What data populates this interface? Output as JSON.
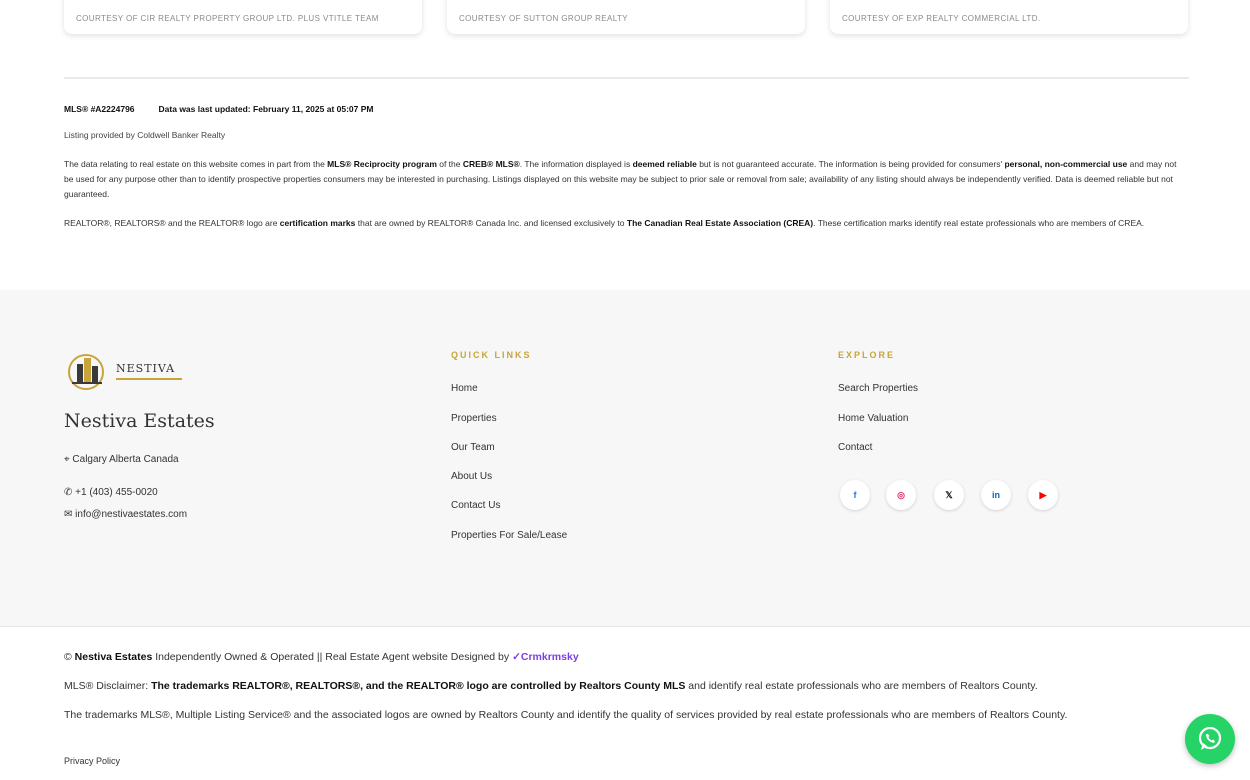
{
  "cards": [
    {
      "credit": "Courtesy of CIR Realty Property Group Ltd. Plus vTitle Team"
    },
    {
      "credit": "Courtesy of Sutton Group Realty"
    },
    {
      "credit": "Courtesy of Exp Realty Commercial Ltd."
    }
  ],
  "disclaimer": {
    "mls": "MLS® #A2224796",
    "updated": "Data was last updated: February 11, 2025 at 05:07 PM",
    "listing": "Listing provided by Coldwell Banker Realty",
    "p1_start": "The data relating to real estate on this website comes in part from the ",
    "p1_b1": "MLS® Reciprocity program",
    "p1_mid1": " of the ",
    "p1_b2": "CREB® MLS®",
    "p1_mid2": ". The information displayed is ",
    "p1_b3": "deemed reliable",
    "p1_mid3": " but is not guaranteed accurate. The information is being provided for consumers' ",
    "p1_b4": "personal, non-commercial use",
    "p1_end": " and may not be used for any purpose other than to identify prospective properties consumers may be interested in purchasing. Listings displayed on this website may be subject to prior sale or removal from sale; availability of any listing should always be independently verified. Data is deemed reliable but not guaranteed.",
    "p2_start": "REALTOR®, REALTORS® and the REALTOR® logo are ",
    "p2_b1": "certification marks",
    "p2_mid": " that are owned by REALTOR® Canada Inc. and licensed exclusively to ",
    "p2_b2": "The Canadian Real Estate Association (CREA)",
    "p2_end": ". These certification marks identify real estate professionals who are members of CREA."
  },
  "footer": {
    "logo_text": "NESTIVA",
    "brand_name": "Nestiva Estates",
    "address": "Calgary Alberta Canada",
    "phone": "+1 (403) 455-0020",
    "email": "info@nestivaestates.com",
    "quick_links": {
      "title": "Quick Links",
      "items": [
        "Home",
        "Properties",
        "Our Team",
        "About Us",
        "Contact Us",
        "Properties For Sale/Lease"
      ]
    },
    "explore": {
      "title": "Explore",
      "items": [
        "Search Properties",
        "Home Valuation",
        "Contact"
      ]
    },
    "social": [
      {
        "icon": "facebook-icon",
        "glyph": "f",
        "color": "#1877f2"
      },
      {
        "icon": "instagram-icon",
        "glyph": "◎",
        "color": "#e1306c"
      },
      {
        "icon": "x-twitter-icon",
        "glyph": "𝕏",
        "color": "#111111"
      },
      {
        "icon": "linkedin-icon",
        "glyph": "in",
        "color": "#0a66c2"
      },
      {
        "icon": "youtube-icon",
        "glyph": "▶",
        "color": "#ff0000"
      }
    ]
  },
  "bottom": {
    "copy_start": "© ",
    "copy_brand": "Nestiva Estates",
    "copy_mid": " Independently Owned & Operated || Real Estate Agent website Designed by ",
    "designer": "Crmkrmsky",
    "line2_start": "MLS® Disclaimer: ",
    "line2_b": "The trademarks REALTOR®, REALTORS®, and the REALTOR® logo are controlled by Realtors County MLS",
    "line2_end": " and identify real estate professionals who are members of Realtors County.",
    "line3": "The trademarks MLS®, Multiple Listing Service® and the associated logos are owned by Realtors County and identify the quality of services provided by real estate professionals who are members of Realtors County.",
    "privacy": "Privacy Policy"
  }
}
